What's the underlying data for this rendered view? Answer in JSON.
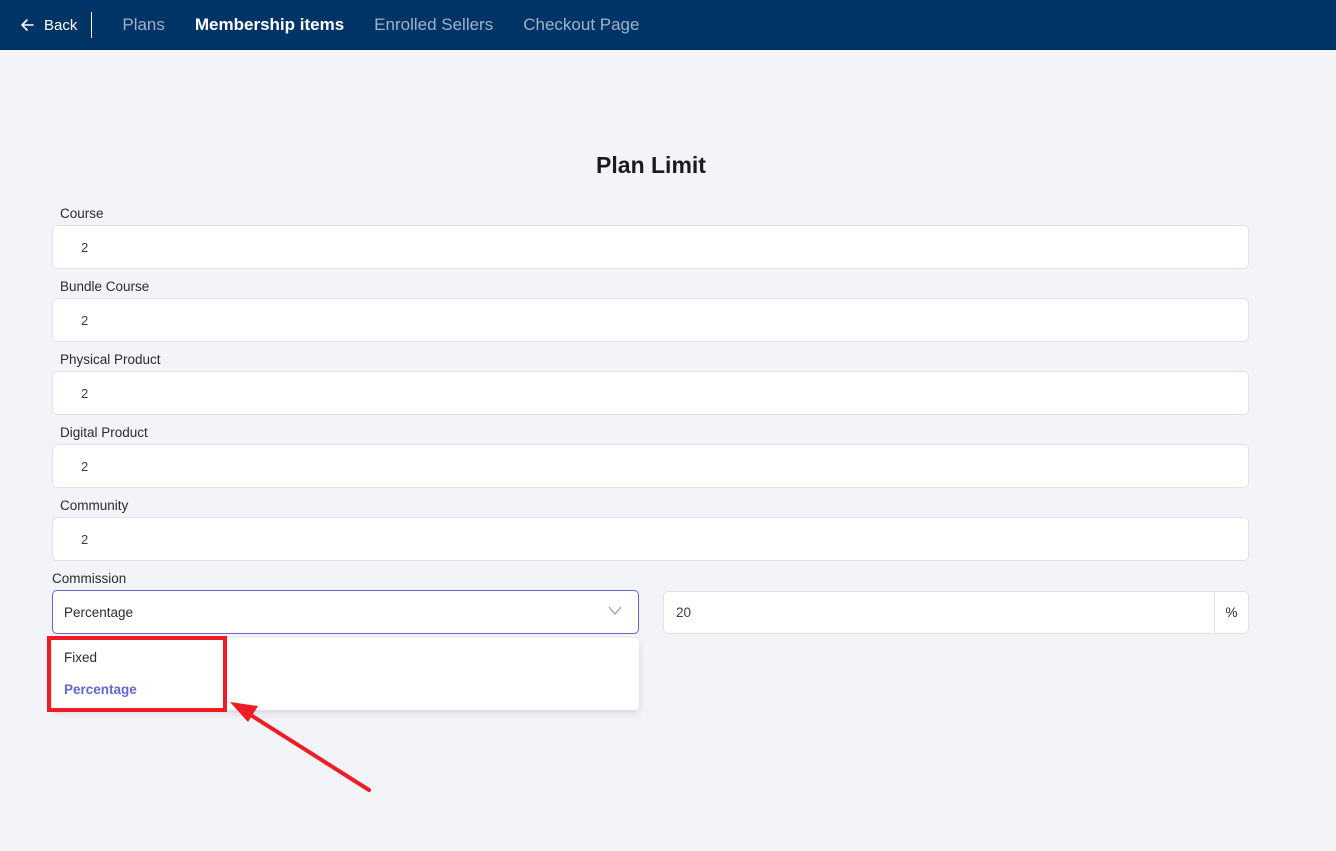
{
  "nav": {
    "back_label": "Back",
    "tabs": [
      {
        "label": "Plans",
        "active": false
      },
      {
        "label": "Membership items",
        "active": true
      },
      {
        "label": "Enrolled Sellers",
        "active": false
      },
      {
        "label": "Checkout Page",
        "active": false
      }
    ]
  },
  "page_title": "Plan Limit",
  "fields": [
    {
      "label": "Course",
      "value": "2"
    },
    {
      "label": "Bundle Course",
      "value": "2"
    },
    {
      "label": "Physical Product",
      "value": "2"
    },
    {
      "label": "Digital Product",
      "value": "2"
    },
    {
      "label": "Community",
      "value": "2"
    }
  ],
  "commission": {
    "label": "Commission",
    "selected": "Percentage",
    "amount": "20",
    "suffix": "%",
    "options": [
      "Fixed",
      "Percentage"
    ]
  },
  "colors": {
    "topbar": "#003366",
    "accent": "#6366d1",
    "annotation": "#ee1c24"
  }
}
